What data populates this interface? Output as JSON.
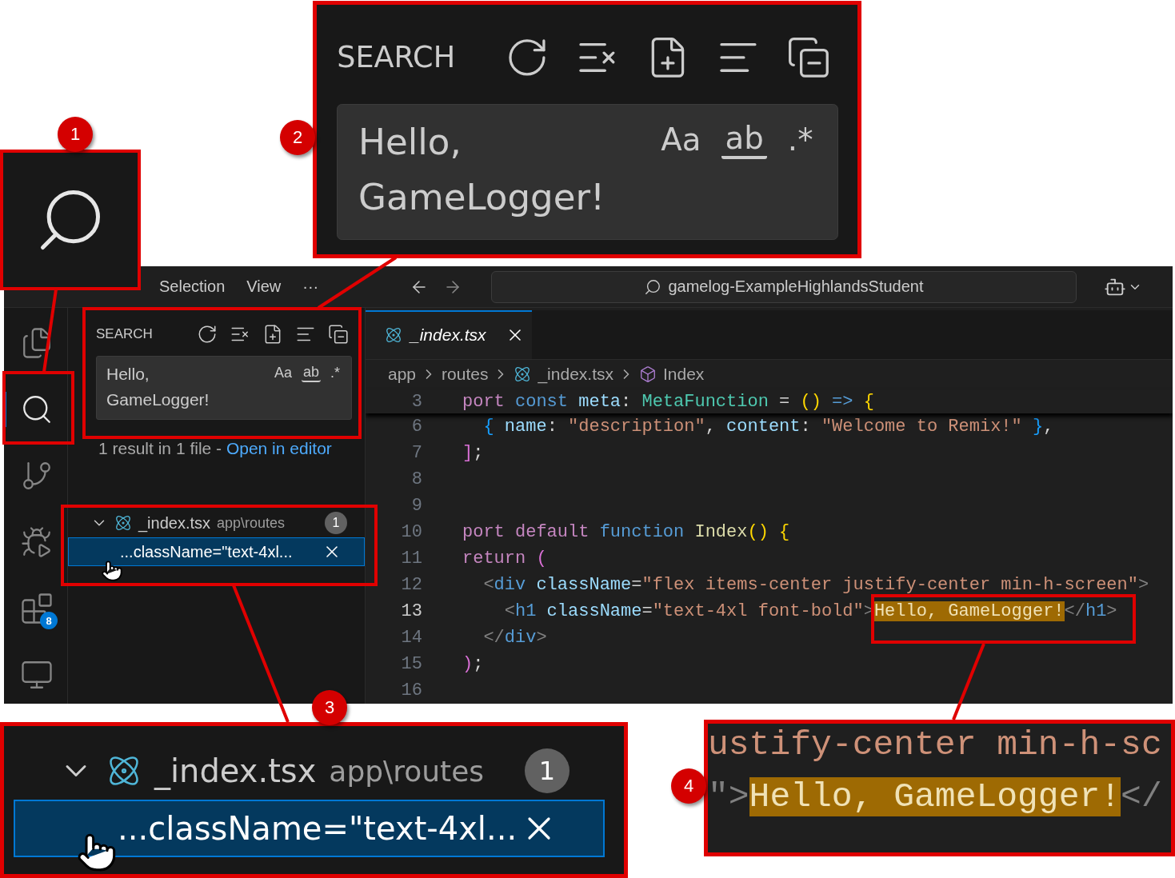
{
  "menu": [
    {
      "label": "Selection"
    },
    {
      "label": "View"
    },
    {
      "label": "···"
    }
  ],
  "command_center": {
    "text": "gamelog-ExampleHighlandsStudent"
  },
  "activity_bar": [
    {
      "kind": "explorer",
      "selected": false
    },
    {
      "kind": "search",
      "selected": true
    },
    {
      "kind": "source-control",
      "selected": false
    },
    {
      "kind": "run-debug",
      "selected": false
    },
    {
      "kind": "extensions",
      "selected": false,
      "badge": "8"
    },
    {
      "kind": "remote",
      "selected": false
    }
  ],
  "search_panel": {
    "title": "SEARCH",
    "query": "Hello, GameLogger!",
    "options": [
      {
        "label": "Aa",
        "kind": "case",
        "selected": false
      },
      {
        "label": "ab",
        "kind": "word",
        "selected": false
      },
      {
        "label": ".*",
        "kind": "regex",
        "selected": false
      }
    ],
    "summary": "1 result in 1 file - ",
    "link": "Open in editor",
    "results": [
      {
        "file": "_index.tsx",
        "path": "app\\routes",
        "count": "1",
        "expanded": true,
        "matches": [
          {
            "text": "...className=\"text-4xl...",
            "selected": true
          }
        ]
      }
    ]
  },
  "editor": {
    "tab": {
      "label": "_index.tsx",
      "selected": true
    },
    "breadcrumbs": [
      {
        "label": "app",
        "kind": "folder"
      },
      {
        "label": "routes",
        "kind": "folder"
      },
      {
        "label": "_index.tsx",
        "kind": "file"
      },
      {
        "label": "Index",
        "kind": "symbol"
      }
    ],
    "lines": [
      {
        "n": "3",
        "sticky": true,
        "current": false,
        "tokens": [
          {
            "t": "port",
            "kind": "ctrl"
          },
          {
            "t": " const",
            "kind": "kw"
          },
          {
            "t": " meta",
            "kind": "var"
          },
          {
            "t": ": ",
            "kind": "plain"
          },
          {
            "t": "MetaFunction",
            "kind": "type"
          },
          {
            "t": " = ",
            "kind": "plain"
          },
          {
            "t": "()",
            "kind": "b1"
          },
          {
            "t": " =>",
            "kind": "kw"
          },
          {
            "t": " {",
            "kind": "b1"
          }
        ]
      },
      {
        "n": "6",
        "sticky": false,
        "current": false,
        "tokens": [
          {
            "t": "  {",
            "kind": "b3"
          },
          {
            "t": " name",
            "kind": "var"
          },
          {
            "t": ": ",
            "kind": "plain"
          },
          {
            "t": "\"description\"",
            "kind": "str"
          },
          {
            "t": ", ",
            "kind": "plain"
          },
          {
            "t": "content",
            "kind": "var"
          },
          {
            "t": ": ",
            "kind": "plain"
          },
          {
            "t": "\"Welcome to Remix!\"",
            "kind": "str"
          },
          {
            "t": " }",
            "kind": "b3"
          },
          {
            "t": ",",
            "kind": "plain"
          }
        ]
      },
      {
        "n": "7",
        "sticky": false,
        "current": false,
        "tokens": [
          {
            "t": "]",
            "kind": "b2"
          },
          {
            "t": ";",
            "kind": "plain"
          }
        ]
      },
      {
        "n": "8",
        "sticky": false,
        "current": false
      },
      {
        "n": "9",
        "sticky": false,
        "current": false
      },
      {
        "n": "10",
        "sticky": false,
        "current": false,
        "tokens": [
          {
            "t": "port",
            "kind": "ctrl"
          },
          {
            "t": " default",
            "kind": "ctrl"
          },
          {
            "t": " function",
            "kind": "kw"
          },
          {
            "t": " Index",
            "kind": "fn"
          },
          {
            "t": "()",
            "kind": "b1"
          },
          {
            "t": " {",
            "kind": "b1"
          }
        ]
      },
      {
        "n": "11",
        "sticky": false,
        "current": false,
        "tokens": [
          {
            "t": "return",
            "kind": "ctrl"
          },
          {
            "t": " (",
            "kind": "b2"
          }
        ]
      },
      {
        "n": "12",
        "sticky": false,
        "current": false,
        "tokens": [
          {
            "t": "  <",
            "kind": "angle"
          },
          {
            "t": "div",
            "kind": "kw"
          },
          {
            "t": " className",
            "kind": "var"
          },
          {
            "t": "=",
            "kind": "plain"
          },
          {
            "t": "\"flex items-center justify-center min-h-screen\"",
            "kind": "str"
          },
          {
            "t": ">",
            "kind": "angle"
          }
        ]
      },
      {
        "n": "13",
        "sticky": false,
        "current": true,
        "tokens": [
          {
            "t": "    <",
            "kind": "angle"
          },
          {
            "t": "h1",
            "kind": "kw"
          },
          {
            "t": " className",
            "kind": "var"
          },
          {
            "t": "=",
            "kind": "plain"
          },
          {
            "t": "\"text-4xl font-bold\"",
            "kind": "str"
          },
          {
            "t": ">",
            "kind": "angle"
          },
          {
            "t": "Hello, GameLogger!",
            "kind": "match"
          },
          {
            "t": "</",
            "kind": "angle"
          },
          {
            "t": "h1",
            "kind": "kw"
          },
          {
            "t": ">",
            "kind": "angle"
          }
        ]
      },
      {
        "n": "14",
        "sticky": false,
        "current": false,
        "tokens": [
          {
            "t": "  </",
            "kind": "angle"
          },
          {
            "t": "div",
            "kind": "kw"
          },
          {
            "t": ">",
            "kind": "angle"
          }
        ]
      },
      {
        "n": "15",
        "sticky": false,
        "current": false,
        "tokens": [
          {
            "t": ")",
            "kind": "b2"
          },
          {
            "t": ";",
            "kind": "plain"
          }
        ]
      },
      {
        "n": "16",
        "sticky": false,
        "current": false
      }
    ]
  },
  "insets": [
    {
      "kind": "activity",
      "callout": "1"
    },
    {
      "kind": "search",
      "callout": "2",
      "title": "SEARCH",
      "query": "Hello, GameLogger!",
      "options": [
        {
          "label": "Aa",
          "kind": "case",
          "selected": false
        },
        {
          "label": "ab",
          "kind": "word",
          "selected": false
        },
        {
          "label": ".*",
          "kind": "regex",
          "selected": false
        }
      ]
    },
    {
      "kind": "result",
      "callout": "3",
      "file": "_index.tsx",
      "path": "app\\routes",
      "count": "1",
      "expanded": true,
      "match": "...className=\"text-4xl...",
      "selected": true
    },
    {
      "kind": "code",
      "callout": "4",
      "lines": [
        [
          {
            "t": "ustify-center min-h-sc",
            "kind": "str"
          }
        ],
        [
          {
            "t": "\">",
            "kind": "angle"
          },
          {
            "t": "Hello, GameLogger!",
            "kind": "match"
          },
          {
            "t": "</",
            "kind": "angle"
          }
        ]
      ]
    }
  ]
}
